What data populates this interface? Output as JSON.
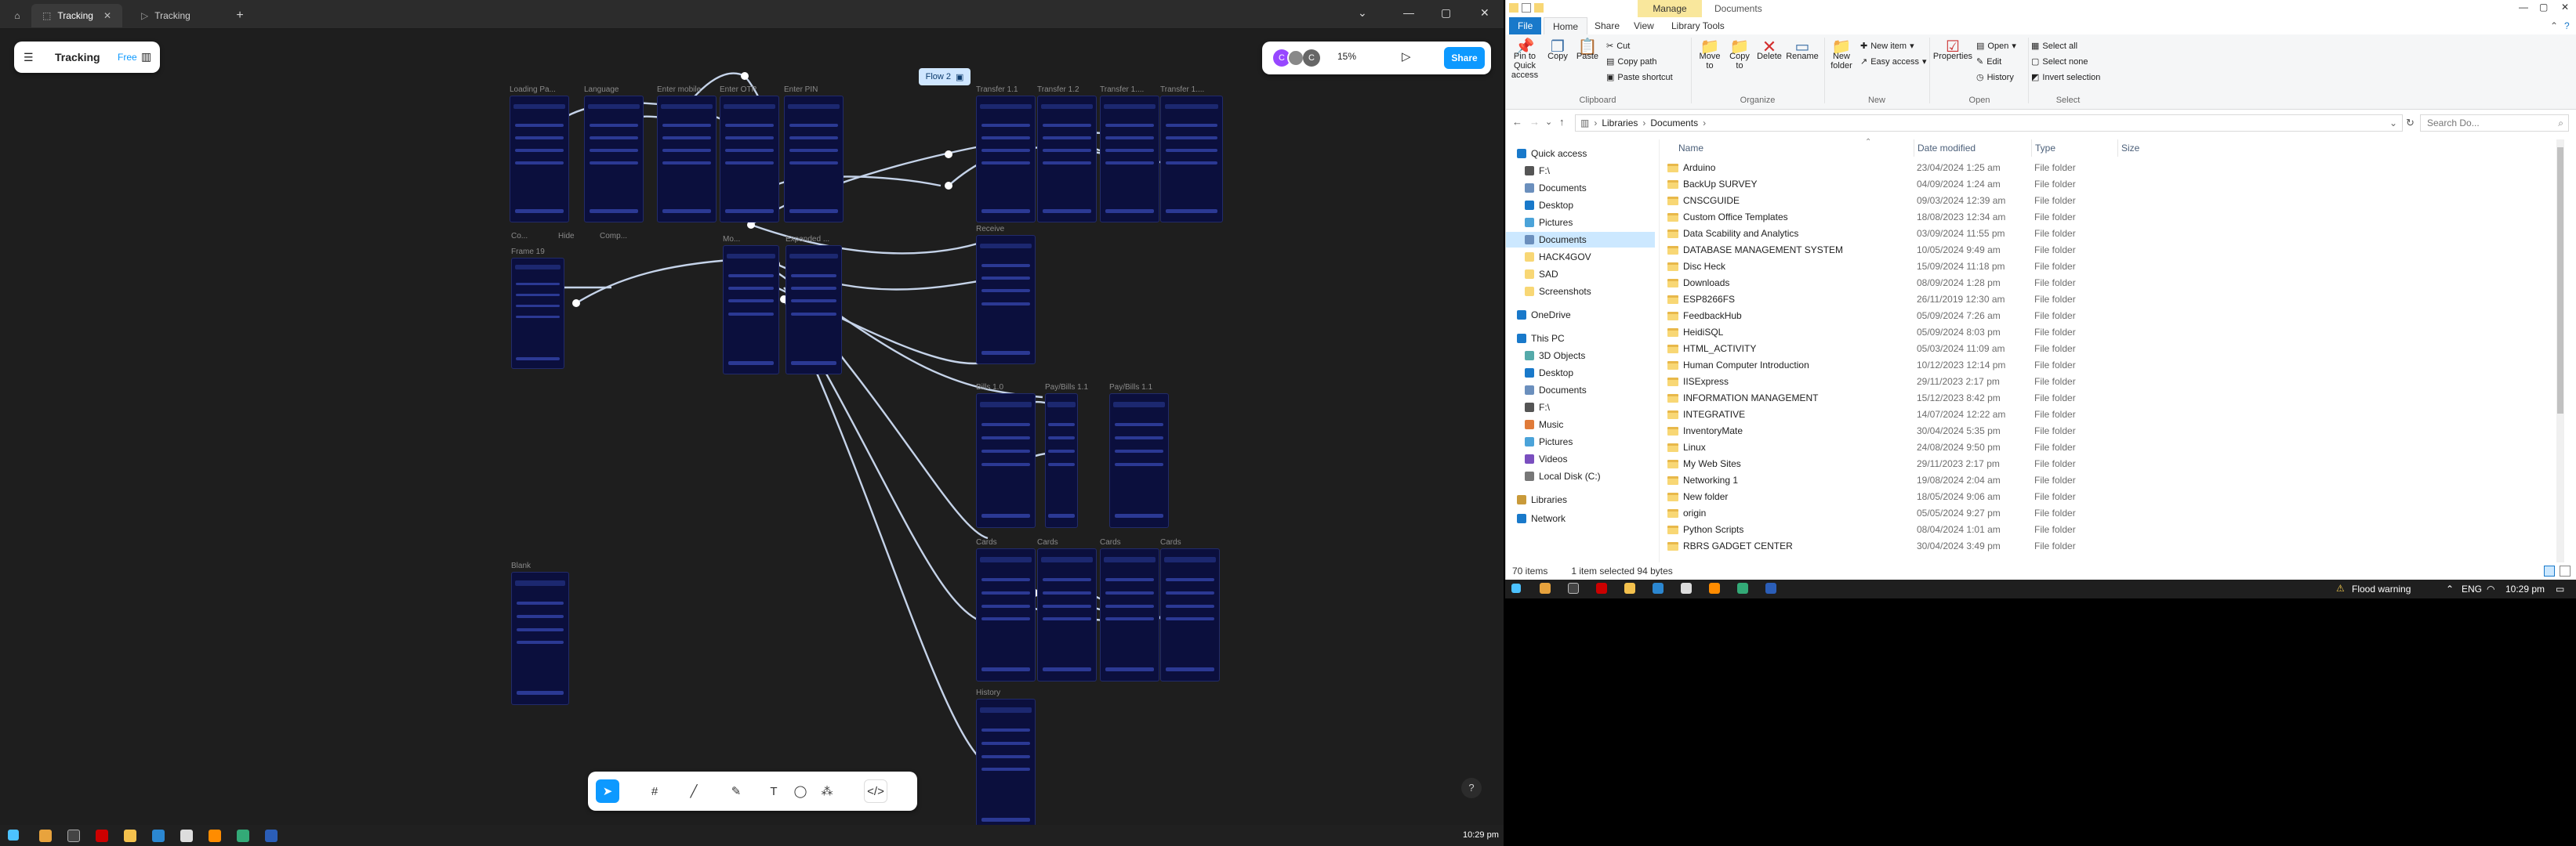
{
  "figma": {
    "tabs": [
      {
        "label": "Tracking"
      },
      {
        "label": "Tracking"
      }
    ],
    "add_tab": "+",
    "file_panel": {
      "name": "Tracking",
      "plan": "Free"
    },
    "zoom": "15%",
    "share": "Share",
    "avatars": [
      "C",
      "C"
    ],
    "flow_label": "Flow 2",
    "frames": [
      {
        "label": "Loading Pa..."
      },
      {
        "label": "Language"
      },
      {
        "label": "Enter mobile"
      },
      {
        "label": "Enter OTP"
      },
      {
        "label": "Enter PIN"
      },
      {
        "label": "Transfer 1.1"
      },
      {
        "label": "Transfer 1.2"
      },
      {
        "label": "Transfer 1...."
      },
      {
        "label": "Transfer 1...."
      },
      {
        "label": "Co..."
      },
      {
        "label": "Hide"
      },
      {
        "label": "Comp..."
      },
      {
        "label": "Frame 19"
      },
      {
        "label": "Mo..."
      },
      {
        "label": "Expanded ..."
      },
      {
        "label": "Receive"
      },
      {
        "label": "Bills 1.0"
      },
      {
        "label": "Pay/Bills 1.1"
      },
      {
        "label": "Pay/Bills 1.1"
      },
      {
        "label": "Blank"
      },
      {
        "label": "Cards"
      },
      {
        "label": "Cards"
      },
      {
        "label": "Cards"
      },
      {
        "label": "Cards"
      },
      {
        "label": "History"
      }
    ],
    "help": "?",
    "accent": "#0d99ff",
    "canvas_bg": "#1e1e1e",
    "frame_bg": "#0b0f3d"
  },
  "explorer": {
    "title_context": "Manage",
    "title": "Documents",
    "tabs": {
      "file": "File",
      "home": "Home",
      "share": "Share",
      "view": "View",
      "library_tools": "Library Tools"
    },
    "ribbon": {
      "pin": "Pin to Quick access",
      "copy": "Copy",
      "paste": "Paste",
      "cut": "Cut",
      "copy_path": "Copy path",
      "paste_shortcut": "Paste shortcut",
      "clipboard": "Clipboard",
      "move_to": "Move to",
      "copy_to": "Copy to",
      "delete": "Delete",
      "rename": "Rename",
      "organize": "Organize",
      "new_folder": "New folder",
      "new_item": "New item",
      "easy_access": "Easy access",
      "new": "New",
      "properties": "Properties",
      "open": "Open",
      "edit": "Edit",
      "history": "History",
      "open_group": "Open",
      "select_all": "Select all",
      "select_none": "Select none",
      "invert_selection": "Invert selection",
      "select": "Select"
    },
    "path": [
      "Libraries",
      "Documents"
    ],
    "search_placeholder": "Search Do...",
    "nav": [
      {
        "label": "Quick access",
        "icon": "star-icon"
      },
      {
        "label": "F:\\",
        "icon": "drive-icon"
      },
      {
        "label": "Documents",
        "icon": "documents-icon"
      },
      {
        "label": "Desktop",
        "icon": "desktop-icon"
      },
      {
        "label": "Pictures",
        "icon": "pictures-icon"
      },
      {
        "label": "Documents",
        "icon": "documents-icon"
      },
      {
        "label": "HACK4GOV",
        "icon": "folder-icon"
      },
      {
        "label": "SAD",
        "icon": "folder-icon"
      },
      {
        "label": "Screenshots",
        "icon": "folder-icon"
      },
      {
        "label": "OneDrive",
        "icon": "cloud-icon"
      },
      {
        "label": "This PC",
        "icon": "pc-icon"
      },
      {
        "label": "3D Objects",
        "icon": "3d-icon"
      },
      {
        "label": "Desktop",
        "icon": "desktop-icon"
      },
      {
        "label": "Documents",
        "icon": "documents-icon"
      },
      {
        "label": "F:\\",
        "icon": "drive-icon"
      },
      {
        "label": "Music",
        "icon": "music-icon"
      },
      {
        "label": "Pictures",
        "icon": "pictures-icon"
      },
      {
        "label": "Videos",
        "icon": "videos-icon"
      },
      {
        "label": "Local Disk (C:)",
        "icon": "disk-icon"
      },
      {
        "label": "Libraries",
        "icon": "libraries-icon"
      },
      {
        "label": "Network",
        "icon": "network-icon"
      }
    ],
    "columns": {
      "name": "Name",
      "date": "Date modified",
      "type": "Type",
      "size": "Size"
    },
    "files": [
      {
        "name": "Arduino",
        "date": "23/04/2024 1:25 am",
        "type": "File folder"
      },
      {
        "name": "BackUp SURVEY",
        "date": "04/09/2024 1:24 am",
        "type": "File folder"
      },
      {
        "name": "CNSCGUIDE",
        "date": "09/03/2024 12:39 am",
        "type": "File folder"
      },
      {
        "name": "Custom Office Templates",
        "date": "18/08/2023 12:34 am",
        "type": "File folder"
      },
      {
        "name": "Data Scability and Analytics",
        "date": "03/09/2024 11:55 pm",
        "type": "File folder"
      },
      {
        "name": "DATABASE MANAGEMENT SYSTEM",
        "date": "10/05/2024 9:49 am",
        "type": "File folder"
      },
      {
        "name": "Disc Heck",
        "date": "15/09/2024 11:18 pm",
        "type": "File folder"
      },
      {
        "name": "Downloads",
        "date": "08/09/2024 1:28 pm",
        "type": "File folder"
      },
      {
        "name": "ESP8266FS",
        "date": "26/11/2019 12:30 am",
        "type": "File folder"
      },
      {
        "name": "FeedbackHub",
        "date": "05/09/2024 7:26 am",
        "type": "File folder"
      },
      {
        "name": "HeidiSQL",
        "date": "05/09/2024 8:03 pm",
        "type": "File folder"
      },
      {
        "name": "HTML_ACTIVITY",
        "date": "05/03/2024 11:09 am",
        "type": "File folder"
      },
      {
        "name": "Human Computer Introduction",
        "date": "10/12/2023 12:14 pm",
        "type": "File folder"
      },
      {
        "name": "IISExpress",
        "date": "29/11/2023 2:17 pm",
        "type": "File folder"
      },
      {
        "name": "INFORMATION MANAGEMENT",
        "date": "15/12/2023 8:42 pm",
        "type": "File folder"
      },
      {
        "name": "INTEGRATIVE",
        "date": "14/07/2024 12:22 am",
        "type": "File folder"
      },
      {
        "name": "InventoryMate",
        "date": "30/04/2024 5:35 pm",
        "type": "File folder"
      },
      {
        "name": "Linux",
        "date": "24/08/2024 9:50 pm",
        "type": "File folder"
      },
      {
        "name": "My Web Sites",
        "date": "29/11/2023 2:17 pm",
        "type": "File folder"
      },
      {
        "name": "Networking 1",
        "date": "19/08/2024 2:04 am",
        "type": "File folder"
      },
      {
        "name": "New folder",
        "date": "18/05/2024 9:06 am",
        "type": "File folder"
      },
      {
        "name": "origin",
        "date": "05/05/2024 9:27 pm",
        "type": "File folder"
      },
      {
        "name": "Python Scripts",
        "date": "08/04/2024 1:01 am",
        "type": "File folder"
      },
      {
        "name": "RBRS GADGET CENTER",
        "date": "30/04/2024 3:49 pm",
        "type": "File folder"
      }
    ],
    "status": {
      "items": "70 items",
      "selected": "1 item selected  94 bytes"
    },
    "select_color": "#cce8ff"
  },
  "taskbar_right": {
    "weather": "Flood warning",
    "lang": "ENG",
    "time": "10:29 pm"
  },
  "taskbar_left": {
    "time": "10:29 pm"
  }
}
